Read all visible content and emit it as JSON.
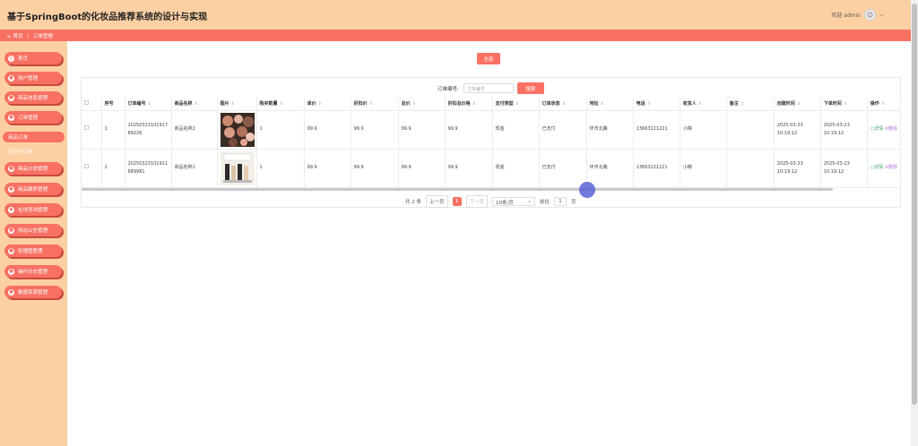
{
  "header": {
    "title": "基于SpringBoot的化妆品推荐系统的设计与实现",
    "welcome": "欢迎 admin"
  },
  "breadcrumb": {
    "home": "首页",
    "sep": "/",
    "current": "订单管理"
  },
  "sidebar": {
    "items": [
      {
        "label": "首页",
        "icon": "home-icon"
      },
      {
        "label": "用户管理",
        "icon": "user-icon"
      },
      {
        "label": "商品信息管理",
        "icon": "product-icon"
      },
      {
        "label": "订单管理",
        "icon": "order-icon"
      }
    ],
    "sub_items": [
      {
        "label": "商品订单",
        "active": true
      },
      {
        "label": "已支付订单",
        "active": false
      }
    ],
    "items2": [
      {
        "label": "商品分类管理",
        "icon": "category-icon"
      },
      {
        "label": "商品服务管理",
        "icon": "service-icon"
      },
      {
        "label": "在线咨询管理",
        "icon": "chat-icon"
      },
      {
        "label": "网站公告管理",
        "icon": "notice-icon"
      },
      {
        "label": "轮播图管理",
        "icon": "carousel-icon"
      },
      {
        "label": "操作日志管理",
        "icon": "log-icon"
      },
      {
        "label": "数据资源管理",
        "icon": "data-icon"
      }
    ]
  },
  "toolbar": {
    "all_label": "全部"
  },
  "search": {
    "label": "订单编号:",
    "placeholder": "订单编号",
    "button": "搜索"
  },
  "table": {
    "headers": [
      "序号",
      "订单编号",
      "商品名称",
      "图片",
      "购买数量",
      "单价",
      "折扣价",
      "总价",
      "折扣总价格",
      "支付类型",
      "订单状态",
      "地址",
      "电话",
      "收货人",
      "备注",
      "创建时间",
      "下单时间",
      "操作"
    ],
    "rows": [
      {
        "no": "1",
        "order_no": "20250323101917 89226",
        "name": "商品名称2",
        "qty": "1",
        "price": "99.9",
        "disc": "99.9",
        "total": "99.9",
        "disc_total": "99.9",
        "pay": "现金",
        "status": "已支付",
        "addr": "环市北路",
        "phone": "13663221221",
        "receiver": "小樽",
        "remark": "",
        "created": "2025-03-23 10:19:12",
        "ordered": "2025-03-23 10:19:12",
        "act_detail": "详情",
        "act_del": "删除"
      },
      {
        "no": "2",
        "order_no": "20250323101911 689981",
        "name": "商品名称1",
        "qty": "1",
        "price": "99.9",
        "disc": "99.9",
        "total": "99.9",
        "disc_total": "99.9",
        "pay": "现金",
        "status": "已支付",
        "addr": "环市北路",
        "phone": "13663221221",
        "receiver": "小樽",
        "remark": "",
        "created": "2025-03-23 10:19:12",
        "ordered": "2025-03-23 10:19:12",
        "act_detail": "详情",
        "act_del": "删除"
      }
    ]
  },
  "pager": {
    "total": "共 2 条",
    "prev": "上一页",
    "page": "1",
    "next": "下一页",
    "size": "10条/页",
    "goto": "前往",
    "goto_value": "1",
    "page_unit": "页"
  },
  "colors": {
    "accent": "#f87163",
    "sidebar_bg": "#fdd0a3"
  }
}
